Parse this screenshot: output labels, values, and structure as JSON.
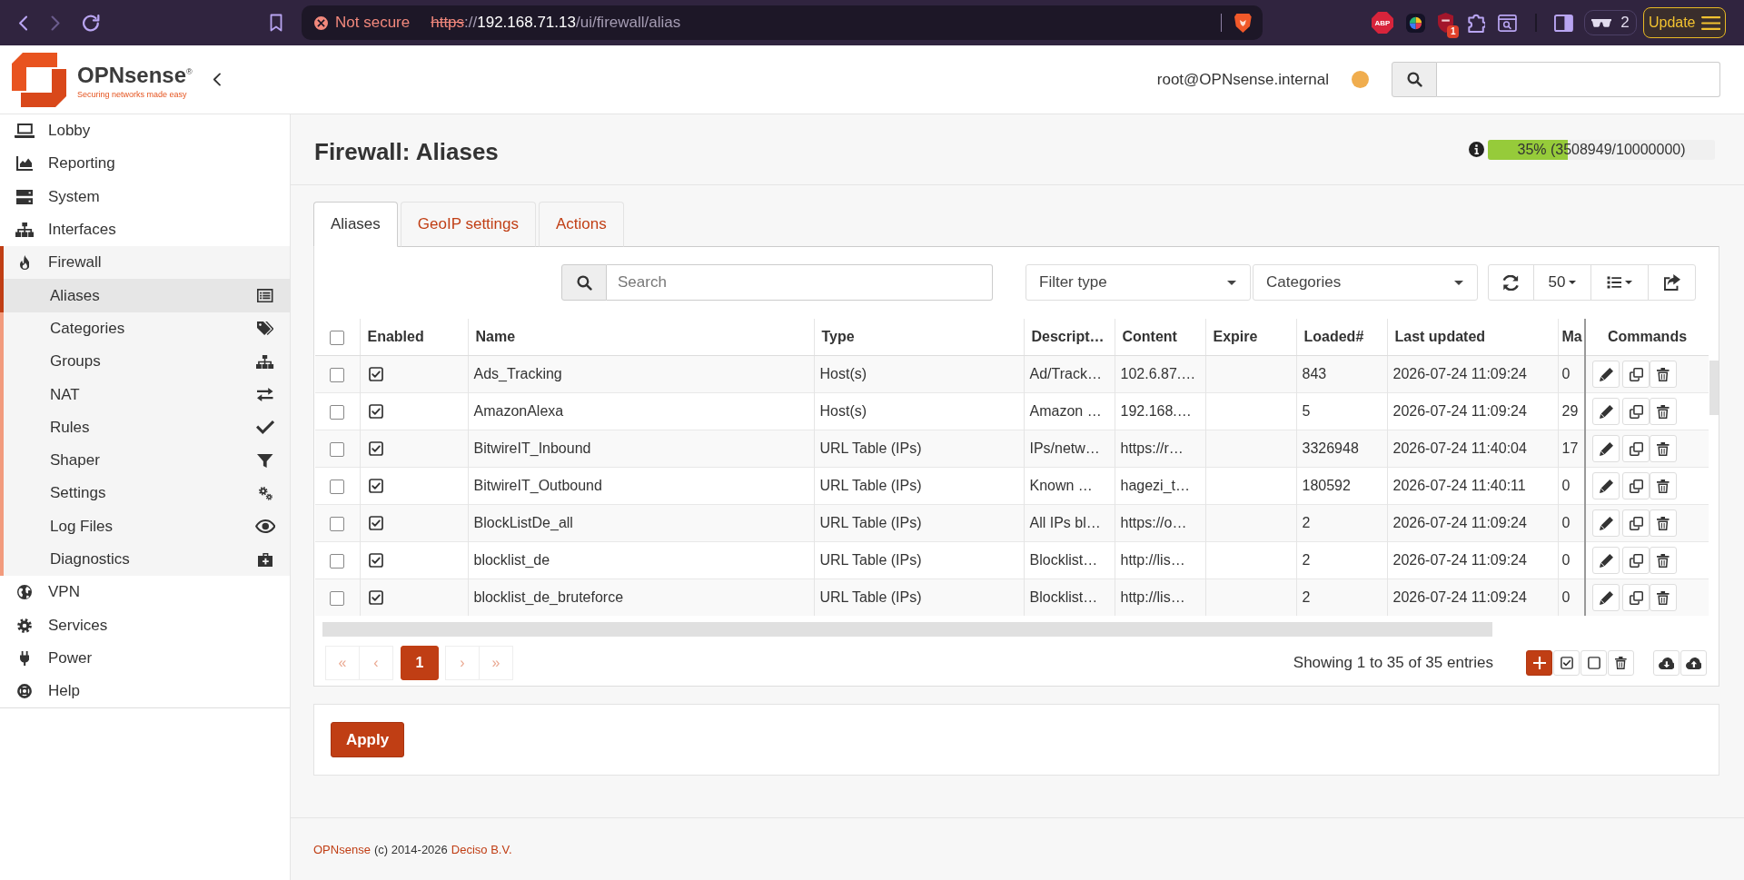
{
  "browser": {
    "nav": [
      {
        "kind": "back",
        "disabled": false
      },
      {
        "kind": "forward",
        "disabled": true
      },
      {
        "kind": "reload",
        "disabled": false
      }
    ],
    "security": "Not secure",
    "url": {
      "scheme": "https",
      "separator": "://",
      "host": "192.168.71.13",
      "path": "/ui/firewall/alias"
    },
    "extensions": [
      {
        "kind": "abp",
        "label": "ABP"
      },
      {
        "kind": "wheel"
      },
      {
        "kind": "shield",
        "badge": "1"
      },
      {
        "kind": "puzzle"
      },
      {
        "kind": "window"
      }
    ],
    "window_count": "2",
    "update": "Update"
  },
  "header": {
    "brand": "OPNsense$^{®}$",
    "tagline": "Securing networks made easy",
    "user": "root@OPNsense.internal",
    "status": {
      "color": "#f0ad4e"
    }
  },
  "sidebar": {
    "items": [
      {
        "label": "Lobby",
        "expanded": false
      },
      {
        "label": "Reporting",
        "expanded": false
      },
      {
        "label": "System",
        "expanded": false
      },
      {
        "label": "Interfaces",
        "expanded": false
      },
      {
        "label": "Firewall",
        "expanded": true,
        "children": [
          {
            "label": "Aliases",
            "selected": true
          },
          {
            "label": "Categories",
            "selected": false
          },
          {
            "label": "Groups",
            "selected": false
          },
          {
            "label": "NAT",
            "selected": false
          },
          {
            "label": "Rules",
            "selected": false
          },
          {
            "label": "Shaper",
            "selected": false
          },
          {
            "label": "Settings",
            "selected": false
          },
          {
            "label": "Log Files",
            "selected": false
          },
          {
            "label": "Diagnostics",
            "selected": false
          }
        ]
      },
      {
        "label": "VPN",
        "expanded": false
      },
      {
        "label": "Services",
        "expanded": false
      },
      {
        "label": "Power",
        "expanded": false
      },
      {
        "label": "Help",
        "expanded": false
      }
    ]
  },
  "page": {
    "title": "Firewall: Aliases",
    "usage": {
      "level": 0.35,
      "reading": "35% (3508949/10000000)"
    }
  },
  "tabs": [
    {
      "label": "Aliases",
      "selected": true
    },
    {
      "label": "GeoIP settings",
      "selected": false
    },
    {
      "label": "Actions",
      "selected": false
    }
  ],
  "toolbar": {
    "search": {
      "placeholder": "Search"
    },
    "filters": [
      {
        "label": "Filter type"
      },
      {
        "label": "Categories"
      }
    ],
    "page_size": "50"
  },
  "table": {
    "select_all": {
      "checked": false
    },
    "columns": [
      "Enabled",
      "Name",
      "Type",
      "Descript…",
      "Content",
      "Expire",
      "Loaded#",
      "Last updated",
      "Ma",
      "Commands"
    ],
    "rows": [
      {
        "selected": false,
        "enabled": true,
        "name": "Ads_Tracking",
        "type": "Host(s)",
        "description": "Ad/Track…",
        "content": "102.6.87.…",
        "loaded": "843",
        "last_updated": "2026-07-24 11:09:24",
        "column_10": "0"
      },
      {
        "selected": false,
        "enabled": true,
        "name": "AmazonAlexa",
        "type": "Host(s)",
        "description": "Amazon …",
        "content": "192.168.…",
        "loaded": "5",
        "last_updated": "2026-07-24 11:09:24",
        "column_10": "29"
      },
      {
        "selected": false,
        "enabled": true,
        "name": "BitwireIT_Inbound",
        "type": "URL Table (IPs)",
        "description": "IPs/netw…",
        "content": "https://r…",
        "loaded": "3326948",
        "last_updated": "2026-07-24 11:40:04",
        "column_10": "17"
      },
      {
        "selected": false,
        "enabled": true,
        "name": "BitwireIT_Outbound",
        "type": "URL Table (IPs)",
        "description": "Known …",
        "content": "hagezi_t…",
        "loaded": "180592",
        "last_updated": "2026-07-24 11:40:11",
        "column_10": "0"
      },
      {
        "selected": false,
        "enabled": true,
        "name": "BlockListDe_all",
        "type": "URL Table (IPs)",
        "description": "All IPs bl…",
        "content": "https://o…",
        "loaded": "2",
        "last_updated": "2026-07-24 11:09:24",
        "column_10": "0"
      },
      {
        "selected": false,
        "enabled": true,
        "name": "blocklist_de",
        "type": "URL Table (IPs)",
        "description": "Blocklist…",
        "content": "http://lis…",
        "loaded": "2",
        "last_updated": "2026-07-24 11:09:24",
        "column_10": "0"
      },
      {
        "selected": false,
        "enabled": true,
        "name": "blocklist_de_bruteforce",
        "type": "URL Table (IPs)",
        "description": "Blocklist…",
        "content": "http://lis…",
        "loaded": "2",
        "last_updated": "2026-07-24 11:09:24",
        "column_10": "0"
      }
    ]
  },
  "pagination": {
    "pages": [
      {
        "label": "«",
        "selected": false,
        "disabled": true
      },
      {
        "label": "‹",
        "selected": false,
        "disabled": true
      },
      {
        "label": "1",
        "selected": true,
        "disabled": false
      },
      {
        "label": "›",
        "selected": false,
        "disabled": true
      },
      {
        "label": "»",
        "selected": false,
        "disabled": true
      }
    ],
    "info": "Showing 1 to 35 of 35 entries"
  },
  "apply": "Apply",
  "footer": {
    "brand": "OPNsense",
    "copyright": "(c) 2014-2026",
    "company": "Deciso B.V."
  }
}
